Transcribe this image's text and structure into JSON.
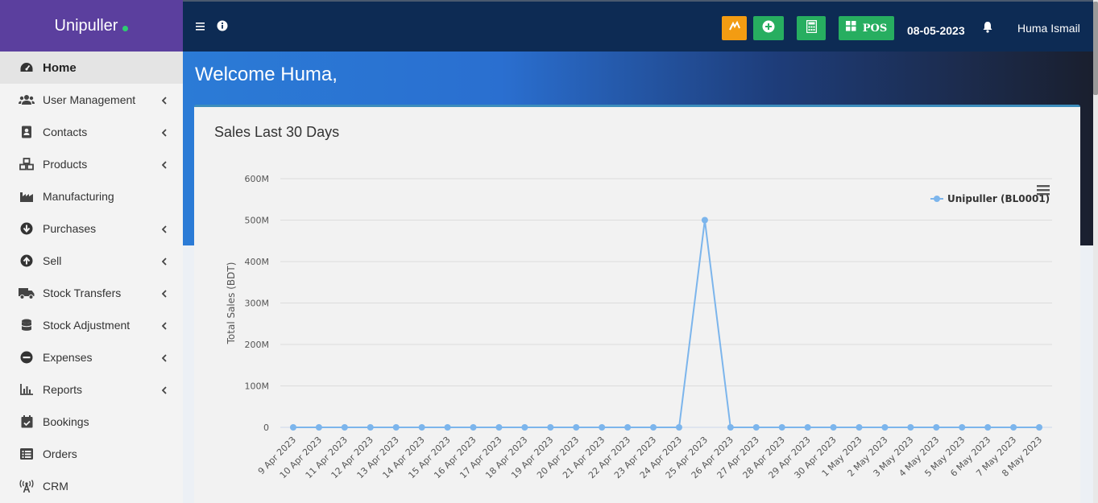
{
  "sidebar": {
    "brand": "Unipuller",
    "items": [
      {
        "label": "Home",
        "icon": "dashboard-icon",
        "active": true,
        "chevron": false
      },
      {
        "label": "User Management",
        "icon": "users-icon",
        "chevron": true
      },
      {
        "label": "Contacts",
        "icon": "address-book-icon",
        "chevron": true
      },
      {
        "label": "Products",
        "icon": "cubes-icon",
        "chevron": true
      },
      {
        "label": "Manufacturing",
        "icon": "industry-icon",
        "chevron": false
      },
      {
        "label": "Purchases",
        "icon": "arrow-circle-down-icon",
        "chevron": true
      },
      {
        "label": "Sell",
        "icon": "arrow-circle-up-icon",
        "chevron": true
      },
      {
        "label": "Stock Transfers",
        "icon": "truck-icon",
        "chevron": true
      },
      {
        "label": "Stock Adjustment",
        "icon": "database-icon",
        "chevron": true
      },
      {
        "label": "Expenses",
        "icon": "minus-circle-icon",
        "chevron": true
      },
      {
        "label": "Reports",
        "icon": "bar-chart-icon",
        "chevron": true
      },
      {
        "label": "Bookings",
        "icon": "calendar-check-icon",
        "chevron": false
      },
      {
        "label": "Orders",
        "icon": "list-icon",
        "chevron": false
      },
      {
        "label": "CRM",
        "icon": "broadcast-icon",
        "chevron": false
      }
    ]
  },
  "header": {
    "pos_label": "POS",
    "date": "08-05-2023",
    "user_name": "Huma Ismail"
  },
  "main": {
    "welcome": "Welcome Huma,",
    "card_title": "Sales Last 30 Days"
  },
  "colors": {
    "brand_bg": "#5b3f9e",
    "topbar_bg": "#0d2b54",
    "series": "#7cb5ec",
    "orange_button": "#f39c12",
    "green_button": "#27ae60"
  },
  "chart_data": {
    "type": "line",
    "title": "",
    "xlabel": "",
    "ylabel": "Total Sales (BDT)",
    "ylim": [
      0,
      600000000
    ],
    "yticks": [
      {
        "value": 0,
        "label": "0"
      },
      {
        "value": 100000000,
        "label": "100M"
      },
      {
        "value": 200000000,
        "label": "200M"
      },
      {
        "value": 300000000,
        "label": "300M"
      },
      {
        "value": 400000000,
        "label": "400M"
      },
      {
        "value": 500000000,
        "label": "500M"
      },
      {
        "value": 600000000,
        "label": "600M"
      }
    ],
    "grid": true,
    "legend_position": "top-right",
    "categories": [
      "9 Apr 2023",
      "10 Apr 2023",
      "11 Apr 2023",
      "12 Apr 2023",
      "13 Apr 2023",
      "14 Apr 2023",
      "15 Apr 2023",
      "16 Apr 2023",
      "17 Apr 2023",
      "18 Apr 2023",
      "19 Apr 2023",
      "20 Apr 2023",
      "21 Apr 2023",
      "22 Apr 2023",
      "23 Apr 2023",
      "24 Apr 2023",
      "25 Apr 2023",
      "26 Apr 2023",
      "27 Apr 2023",
      "28 Apr 2023",
      "29 Apr 2023",
      "30 Apr 2023",
      "1 May 2023",
      "2 May 2023",
      "3 May 2023",
      "4 May 2023",
      "5 May 2023",
      "6 May 2023",
      "7 May 2023",
      "8 May 2023"
    ],
    "series": [
      {
        "name": "Unipuller (BL0001)",
        "values": [
          0,
          0,
          0,
          0,
          0,
          0,
          0,
          0,
          0,
          0,
          0,
          0,
          0,
          0,
          0,
          0,
          500000000,
          0,
          0,
          0,
          0,
          0,
          0,
          0,
          0,
          0,
          0,
          0,
          0,
          0
        ]
      }
    ]
  }
}
